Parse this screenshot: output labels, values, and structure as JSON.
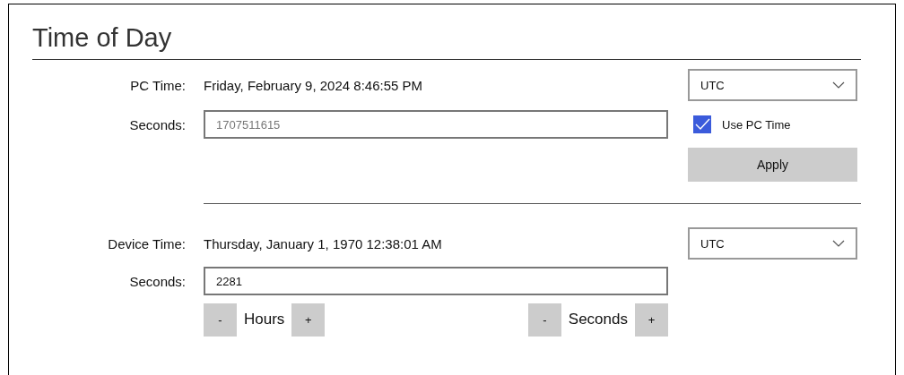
{
  "title": "Time of Day",
  "pc": {
    "label": "PC Time:",
    "value": "Friday, February 9, 2024 8:46:55 PM",
    "seconds_label": "Seconds:",
    "seconds": {
      "value": "1707511615",
      "disabled": true
    },
    "timezone": "UTC",
    "use_pc_time": {
      "label": "Use PC Time",
      "checked": true
    },
    "apply": "Apply"
  },
  "device": {
    "label": "Device Time:",
    "value": "Thursday, January 1, 1970 12:38:01 AM",
    "seconds_label": "Seconds:",
    "seconds": {
      "value": "2281",
      "disabled": false
    },
    "timezone": "UTC",
    "steppers": [
      {
        "minus": "-",
        "label": "Hours",
        "plus": "+"
      },
      {
        "minus": "-",
        "label": "Seconds",
        "plus": "+"
      }
    ]
  }
}
